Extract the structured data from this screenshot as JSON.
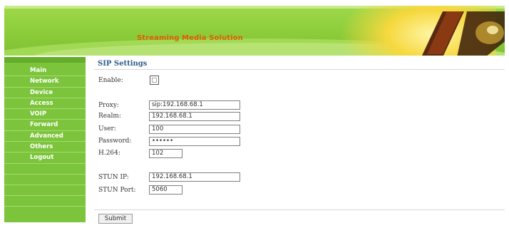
{
  "header": {
    "title": "Streaming Media Solution"
  },
  "sidebar": {
    "items": [
      {
        "label": "Main"
      },
      {
        "label": "Network"
      },
      {
        "label": "Device"
      },
      {
        "label": "Access"
      },
      {
        "label": "VOIP"
      },
      {
        "label": "Forward"
      },
      {
        "label": "Advanced"
      },
      {
        "label": "Others"
      },
      {
        "label": "Logout"
      }
    ]
  },
  "page": {
    "title": "SIP Settings",
    "enable": {
      "label": "Enable:",
      "checked": false
    },
    "fields": {
      "proxy": {
        "label": "Proxy:",
        "value": "sip:192.168.68.1"
      },
      "realm": {
        "label": "Realm:",
        "value": "192.168.68.1"
      },
      "user": {
        "label": "User:",
        "value": "100"
      },
      "password": {
        "label": "Password:",
        "value": "••••••"
      },
      "h264": {
        "label": "H.264:",
        "value": "102"
      },
      "stun_ip": {
        "label": "STUN IP:",
        "value": "192.168.68.1"
      },
      "stun_port": {
        "label": "STUN Port:",
        "value": "5060"
      }
    },
    "submit_label": "Submit"
  },
  "colors": {
    "banner_green": "#8fcf3c",
    "sidebar_green": "#7cc43c",
    "title_orange": "#e25c00",
    "section_title_blue": "#2e5d8c"
  }
}
